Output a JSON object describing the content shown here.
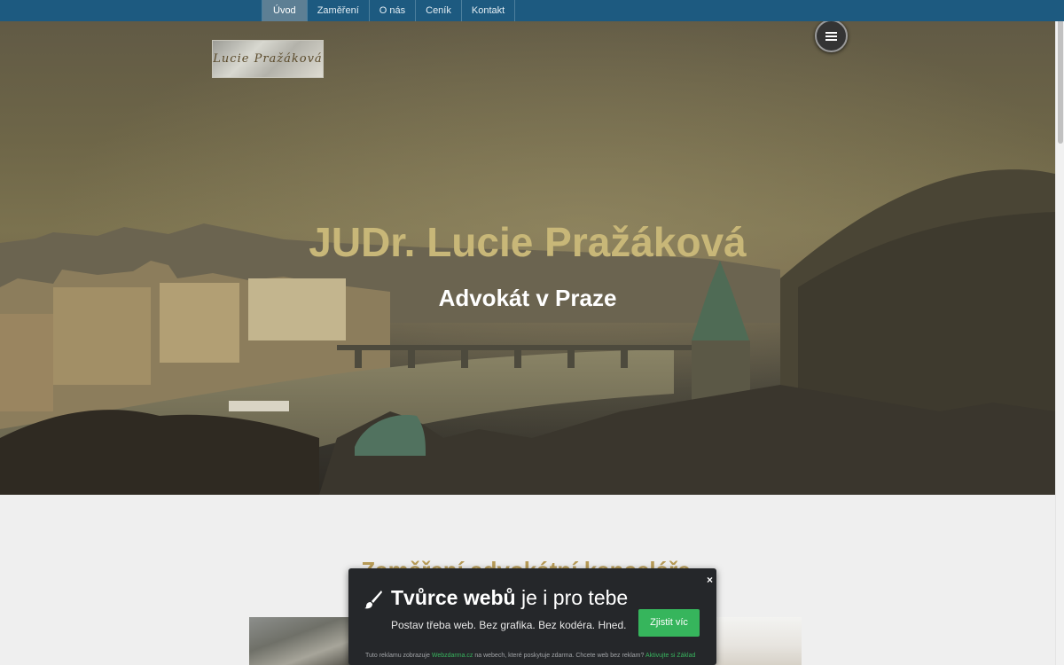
{
  "nav": {
    "items": [
      "Úvod",
      "Zaměření",
      "O nás",
      "Ceník",
      "Kontakt"
    ],
    "active_index": 0
  },
  "hero": {
    "logo_text": "Lucie Pražáková",
    "title": "JUDr. Lucie Pražáková",
    "subtitle": "Advokát v Praze",
    "menu_icon": "hamburger-icon"
  },
  "section": {
    "title": "Zaměření advokátní kanceláře"
  },
  "ad": {
    "close_label": "×",
    "brush_icon": "brush-icon",
    "title_bold": "Tvůrce webů",
    "title_rest": " je i pro tebe",
    "line": "Postav třeba web. Bez grafika. Bez kodéra. Hned.",
    "cta": "Zjistit víc",
    "foot_pre": "Tuto reklamu zobrazuje ",
    "foot_link1": "Webzdarma.cz",
    "foot_mid": " na webech, které poskytuje zdarma. Chcete web bez reklam? ",
    "foot_link2": "Aktivujte si Základ"
  },
  "colors": {
    "nav_bg": "#1d5a80",
    "hero_title": "#c8b778",
    "section_title": "#b89c58",
    "cta_green": "#36b55c"
  }
}
